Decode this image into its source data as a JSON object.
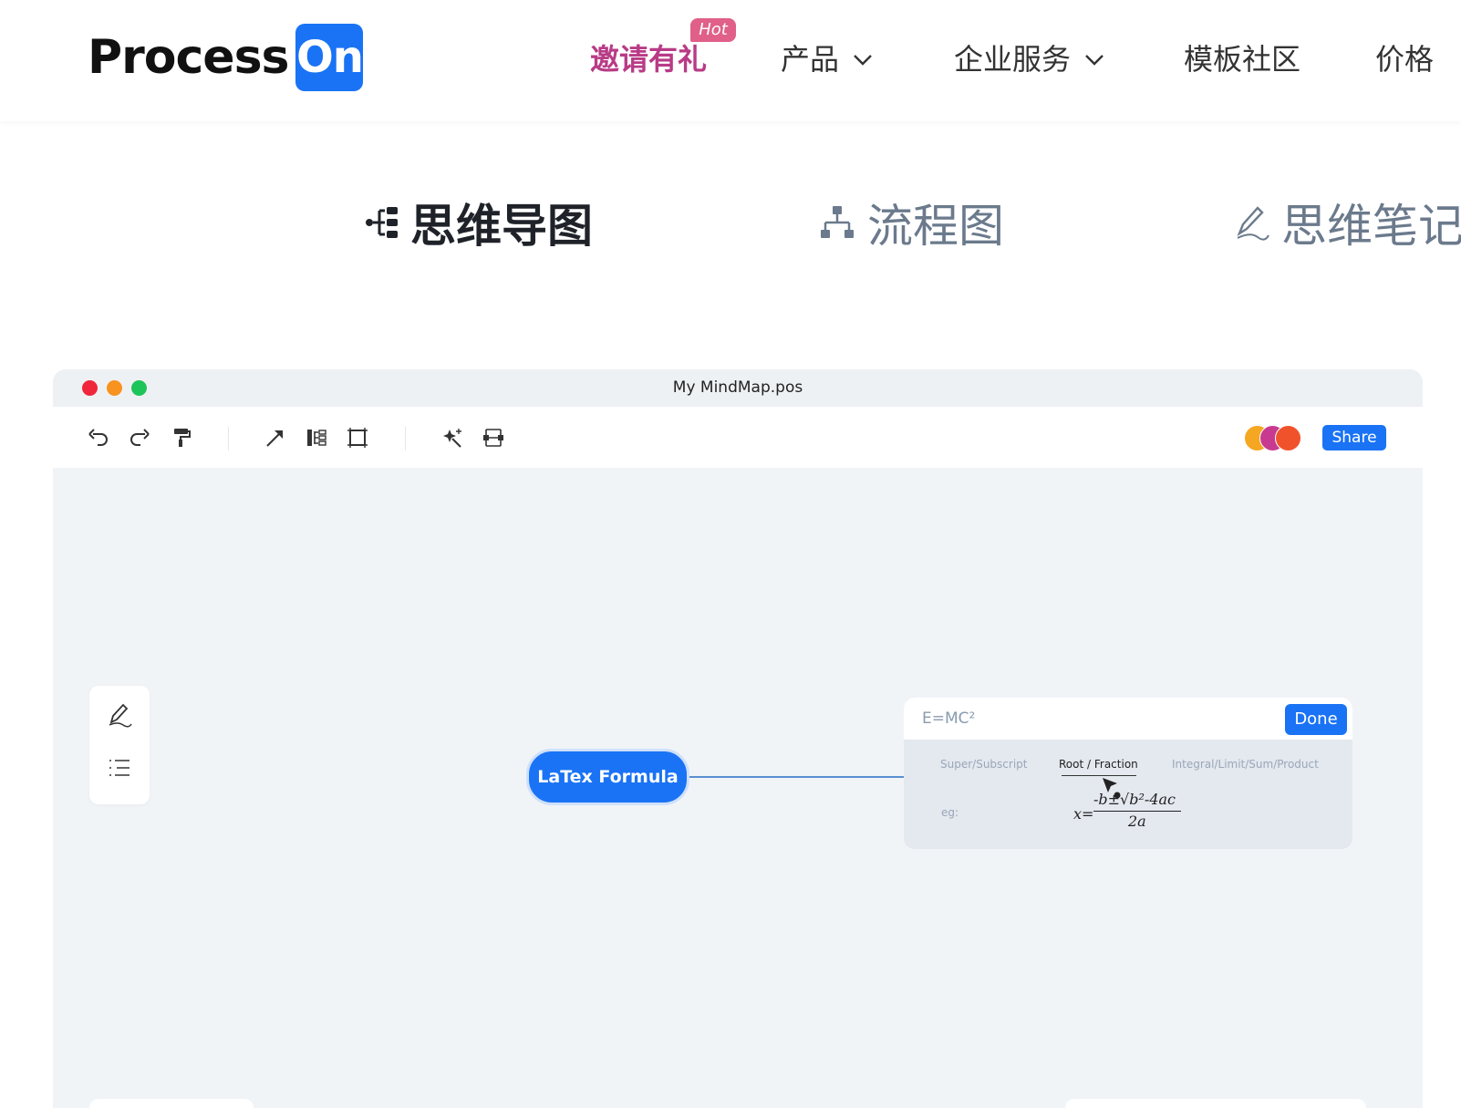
{
  "brand": {
    "word": "Process",
    "badge": "On",
    "color": "#1a73f5"
  },
  "nav": {
    "invite": "邀请有礼",
    "hot": "Hot",
    "product": "产品",
    "enterprise": "企业服务",
    "templates": "模板社区",
    "pricing": "价格"
  },
  "tabs": {
    "mindmap": "思维导图",
    "flowchart": "流程图",
    "notes": "思维笔记"
  },
  "window": {
    "title": "My MindMap.pos",
    "share": "Share",
    "node": "LaTex Formula",
    "latex": {
      "input_value": "E=MC²",
      "done": "Done",
      "tab_super": "Super/Subscript",
      "tab_root": "Root / Fraction",
      "tab_integral": "Integral/Limit/Sum/Product",
      "eg": "eg:",
      "formula_lhs": "x=",
      "formula_num": "-b±√b²-4ac",
      "formula_den": "2a"
    }
  },
  "colors": {
    "accent": "#1a73f5",
    "invite": "#b83b86",
    "hot_badge": "#e0608a",
    "close": "#f0263c",
    "minimize": "#f7931e",
    "maximize": "#1ec45a"
  },
  "icons": [
    "undo-icon",
    "redo-icon",
    "format-painter-icon",
    "arrow-icon",
    "layout-icon",
    "frame-icon",
    "magic-icon",
    "structure-icon",
    "pen-icon",
    "outline-icon",
    "chevron-down-icon",
    "mindmap-icon",
    "flowchart-icon",
    "pencil-icon"
  ]
}
